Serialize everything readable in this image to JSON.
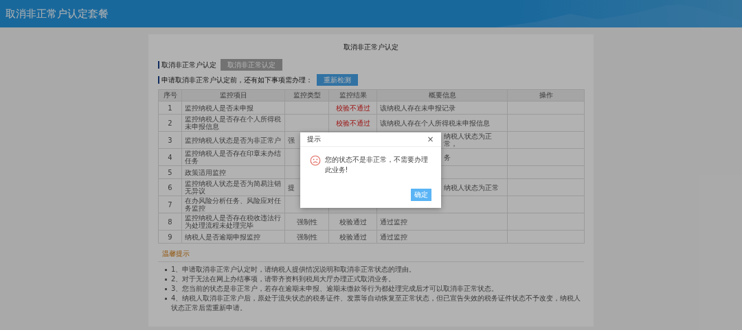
{
  "header": {
    "title": "取消非正常户认定套餐"
  },
  "card": {
    "title": "取消非正常户认定",
    "sections": [
      {
        "label": "取消非正常户认定",
        "button": {
          "label": "取消非正常认定",
          "disabled": true
        }
      },
      {
        "label": "申请取消非正常户认定前，还有如下事项需办理：",
        "button": {
          "label": "重新检测",
          "disabled": false
        }
      }
    ],
    "table": {
      "columns": [
        "序号",
        "监控项目",
        "监控类型",
        "监控结果",
        "概要信息",
        "操作"
      ],
      "rows": [
        {
          "cells": [
            {
              "text": "1"
            },
            {
              "text": "监控纳税人是否未申报"
            },
            {},
            {
              "text": "校验不通过",
              "failed": true
            },
            {
              "text": "该纳税人存在未申报记录"
            },
            {}
          ]
        },
        {
          "cells": [
            {
              "text": "2"
            },
            {
              "text": "监控纳税人是否存在个人所得税未申报信息"
            },
            {},
            {
              "text": "校验不通过",
              "failed": true
            },
            {
              "text": "该纳税人存在个人所得税未申报信息"
            },
            {}
          ]
        },
        {
          "cells": [
            {
              "text": "3"
            },
            {
              "text": "监控纳税人状态是否为非正常户"
            },
            {
              "text": "强",
              "cut": true
            },
            {},
            {
              "text": "纳税人状态为正常，",
              "cut": true
            },
            {}
          ]
        },
        {
          "cells": [
            {
              "text": "4"
            },
            {
              "text": "监控纳税人是否存在印章未办结任务"
            },
            {},
            {},
            {
              "text": "务",
              "cut": true
            },
            {}
          ]
        },
        {
          "cells": [
            {
              "text": "5"
            },
            {
              "text": "政策适用监控"
            },
            {},
            {},
            {},
            {}
          ]
        },
        {
          "cells": [
            {
              "text": "6"
            },
            {
              "text": "监控纳税人状态是否为简易注销无异议"
            },
            {
              "text": "提",
              "cut": true
            },
            {},
            {
              "text": "纳税人状态为正常",
              "cut": true
            },
            {}
          ]
        },
        {
          "cells": [
            {
              "text": "7"
            },
            {
              "text": "在办风险分析任务、风险应对任务监控"
            },
            {},
            {},
            {},
            {}
          ]
        },
        {
          "cells": [
            {
              "text": "8"
            },
            {
              "text": "监控纳税人是否存在税收违法行为处理流程未处理完毕"
            },
            {
              "text": "强制性"
            },
            {
              "text": "校验通过",
              "failed": false
            },
            {
              "text": "通过监控"
            },
            {}
          ]
        },
        {
          "cells": [
            {
              "text": "9"
            },
            {
              "text": "纳税人是否逾期申报监控"
            },
            {
              "text": "强制性"
            },
            {
              "text": "校验通过",
              "failed": false
            },
            {
              "text": "通过监控"
            },
            {}
          ]
        }
      ]
    },
    "tips": {
      "title": "温馨提示",
      "items": [
        "1、申请取消非正常户认定时，请纳税人提供情况说明和取消非正常状态的理由。",
        "2、对于无法在网上办结事项，请带齐资料到税局大厅办理正式取消业务。",
        "3、您当前的状态是非正常户，若存在逾期未申报、逾期未缴款等行为都处理完成后才可以取消非正常状态。",
        "4、纳税人取消非正常户后，原处于流失状态的税务证件、发票等自动恢复至正常状态，但已宣告失效的税务证件状态不予改变，纳税人状态正常后需重新申请。"
      ]
    }
  },
  "dialog": {
    "title": "提示",
    "close": "×",
    "message": "您的状态不是非正常，不需要办理此业务!",
    "button": "确定"
  }
}
